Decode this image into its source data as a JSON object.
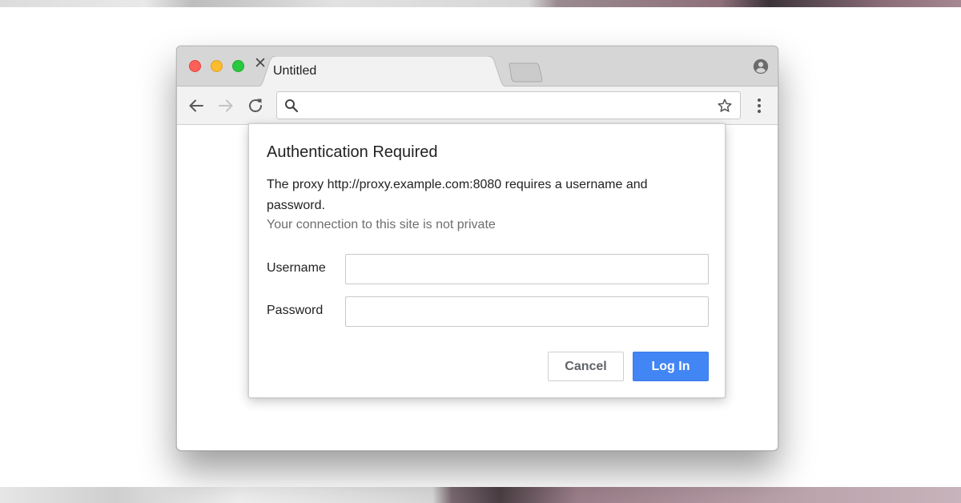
{
  "browser": {
    "tab": {
      "title": "Untitled",
      "close_glyph": "×"
    },
    "omnibox": {
      "value": "",
      "placeholder": ""
    },
    "icons": {
      "back": "arrow-left-icon",
      "forward": "arrow-right-icon",
      "reload": "reload-icon",
      "search": "search-icon",
      "bookmark": "star-icon",
      "menu": "kebab-menu-icon",
      "profile": "account-circle-icon"
    }
  },
  "dialog": {
    "title": "Authentication Required",
    "message": "The proxy http://proxy.example.com:8080 requires a username and password.",
    "subtext": "Your connection to this site is not private",
    "username_label": "Username",
    "username_value": "",
    "password_label": "Password",
    "password_value": "",
    "cancel_label": "Cancel",
    "login_label": "Log In"
  },
  "colors": {
    "accent": "#4285f4",
    "close_red": "#fc5f57",
    "minimize_yellow": "#fdbc2e",
    "zoom_green": "#29c841",
    "subtext_gray": "#6e6e6e"
  }
}
